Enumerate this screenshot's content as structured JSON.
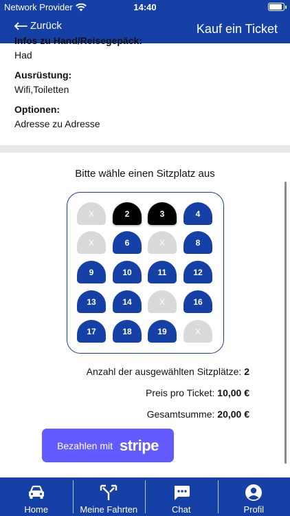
{
  "status_bar": {
    "carrier": "Network Provider",
    "time": "14:40"
  },
  "header": {
    "back_label": "Zurück",
    "title": "Kauf ein Ticket"
  },
  "details": {
    "cut_label": "Infos zu Hand/Reisegepäck:",
    "cut_value": "Had",
    "fields": [
      {
        "label": "Ausrüstung:",
        "value": "Wifi,Toiletten"
      },
      {
        "label": "Optionen:",
        "value": "Adresse zu Adresse"
      }
    ]
  },
  "seat_section": {
    "heading": "Bitte wähle einen Sitzplatz aus",
    "colors": {
      "available": "#1540a6",
      "taken": "#d9d9d9",
      "selected": "#000000"
    },
    "rows": [
      [
        {
          "label": "X",
          "state": "taken"
        },
        {
          "label": "2",
          "state": "selected"
        },
        {
          "label": "3",
          "state": "selected"
        },
        {
          "label": "4",
          "state": "available"
        }
      ],
      [
        {
          "label": "X",
          "state": "taken"
        },
        {
          "label": "6",
          "state": "available"
        },
        {
          "label": "X",
          "state": "taken"
        },
        {
          "label": "8",
          "state": "available"
        }
      ],
      [
        {
          "label": "9",
          "state": "available"
        },
        {
          "label": "10",
          "state": "available"
        },
        {
          "label": "11",
          "state": "available"
        },
        {
          "label": "12",
          "state": "available"
        }
      ],
      [
        {
          "label": "13",
          "state": "available"
        },
        {
          "label": "14",
          "state": "available"
        },
        {
          "label": "X",
          "state": "taken"
        },
        {
          "label": "16",
          "state": "available"
        }
      ],
      [
        {
          "label": "17",
          "state": "available"
        },
        {
          "label": "18",
          "state": "available"
        },
        {
          "label": "19",
          "state": "available"
        },
        {
          "label": "X",
          "state": "taken"
        }
      ]
    ]
  },
  "summary": {
    "count_label": "Anzahl der ausgewählten Sitzplätze:",
    "count_value": "2",
    "price_label": "Preis pro Ticket:",
    "price_value": "10,00 €",
    "total_label": "Gesamtsumme:",
    "total_value": "20,00 €"
  },
  "pay_button": {
    "label": "Bezahlen mit",
    "logo_text": "stripe",
    "color": "#635bff"
  },
  "tabbar": {
    "items": [
      {
        "label": "Home",
        "icon": "car-icon"
      },
      {
        "label": "Meine Fahrten",
        "icon": "routes-icon"
      },
      {
        "label": "Chat",
        "icon": "chat-icon"
      },
      {
        "label": "Profil",
        "icon": "profile-icon"
      }
    ]
  }
}
